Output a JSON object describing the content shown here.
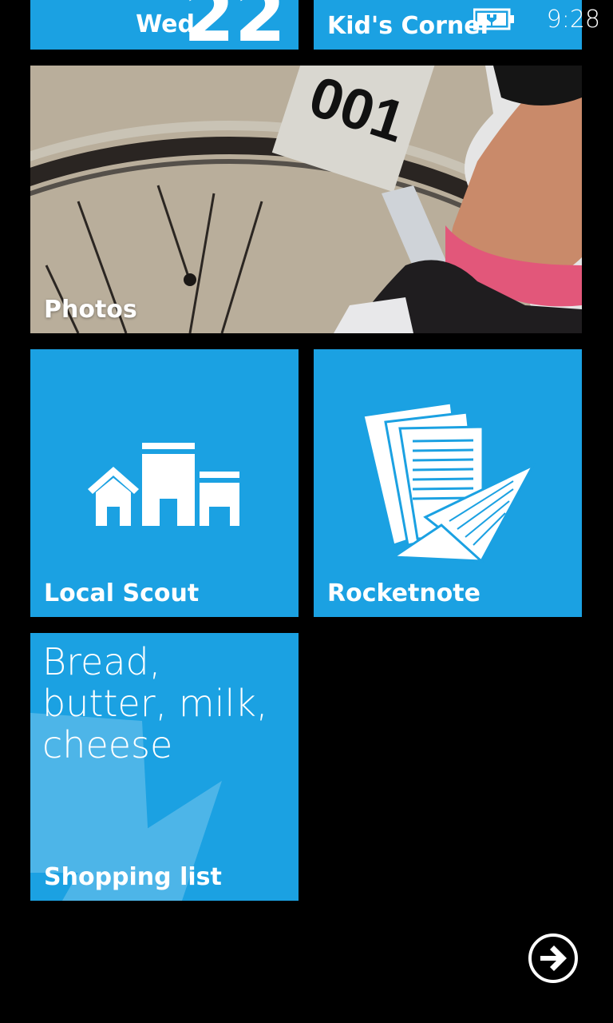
{
  "status_bar": {
    "time": "9:28"
  },
  "tiles": {
    "calendar": {
      "day": "Wed",
      "date": "22"
    },
    "kids_corner": {
      "label": "Kid's Corner"
    },
    "photos": {
      "label": "Photos",
      "photo_text": "001"
    },
    "local_scout": {
      "label": "Local Scout"
    },
    "rocketnote": {
      "label": "Rocketnote"
    },
    "shopping_list": {
      "label": "Shopping list",
      "note": "Bread, butter, milk, cheese"
    }
  },
  "colors": {
    "tile": "#1ba1e2",
    "background": "#000000"
  },
  "icons": [
    "battery-charging-icon",
    "houses-icon",
    "documents-paper-plane-icon",
    "arrow-right-icon"
  ]
}
